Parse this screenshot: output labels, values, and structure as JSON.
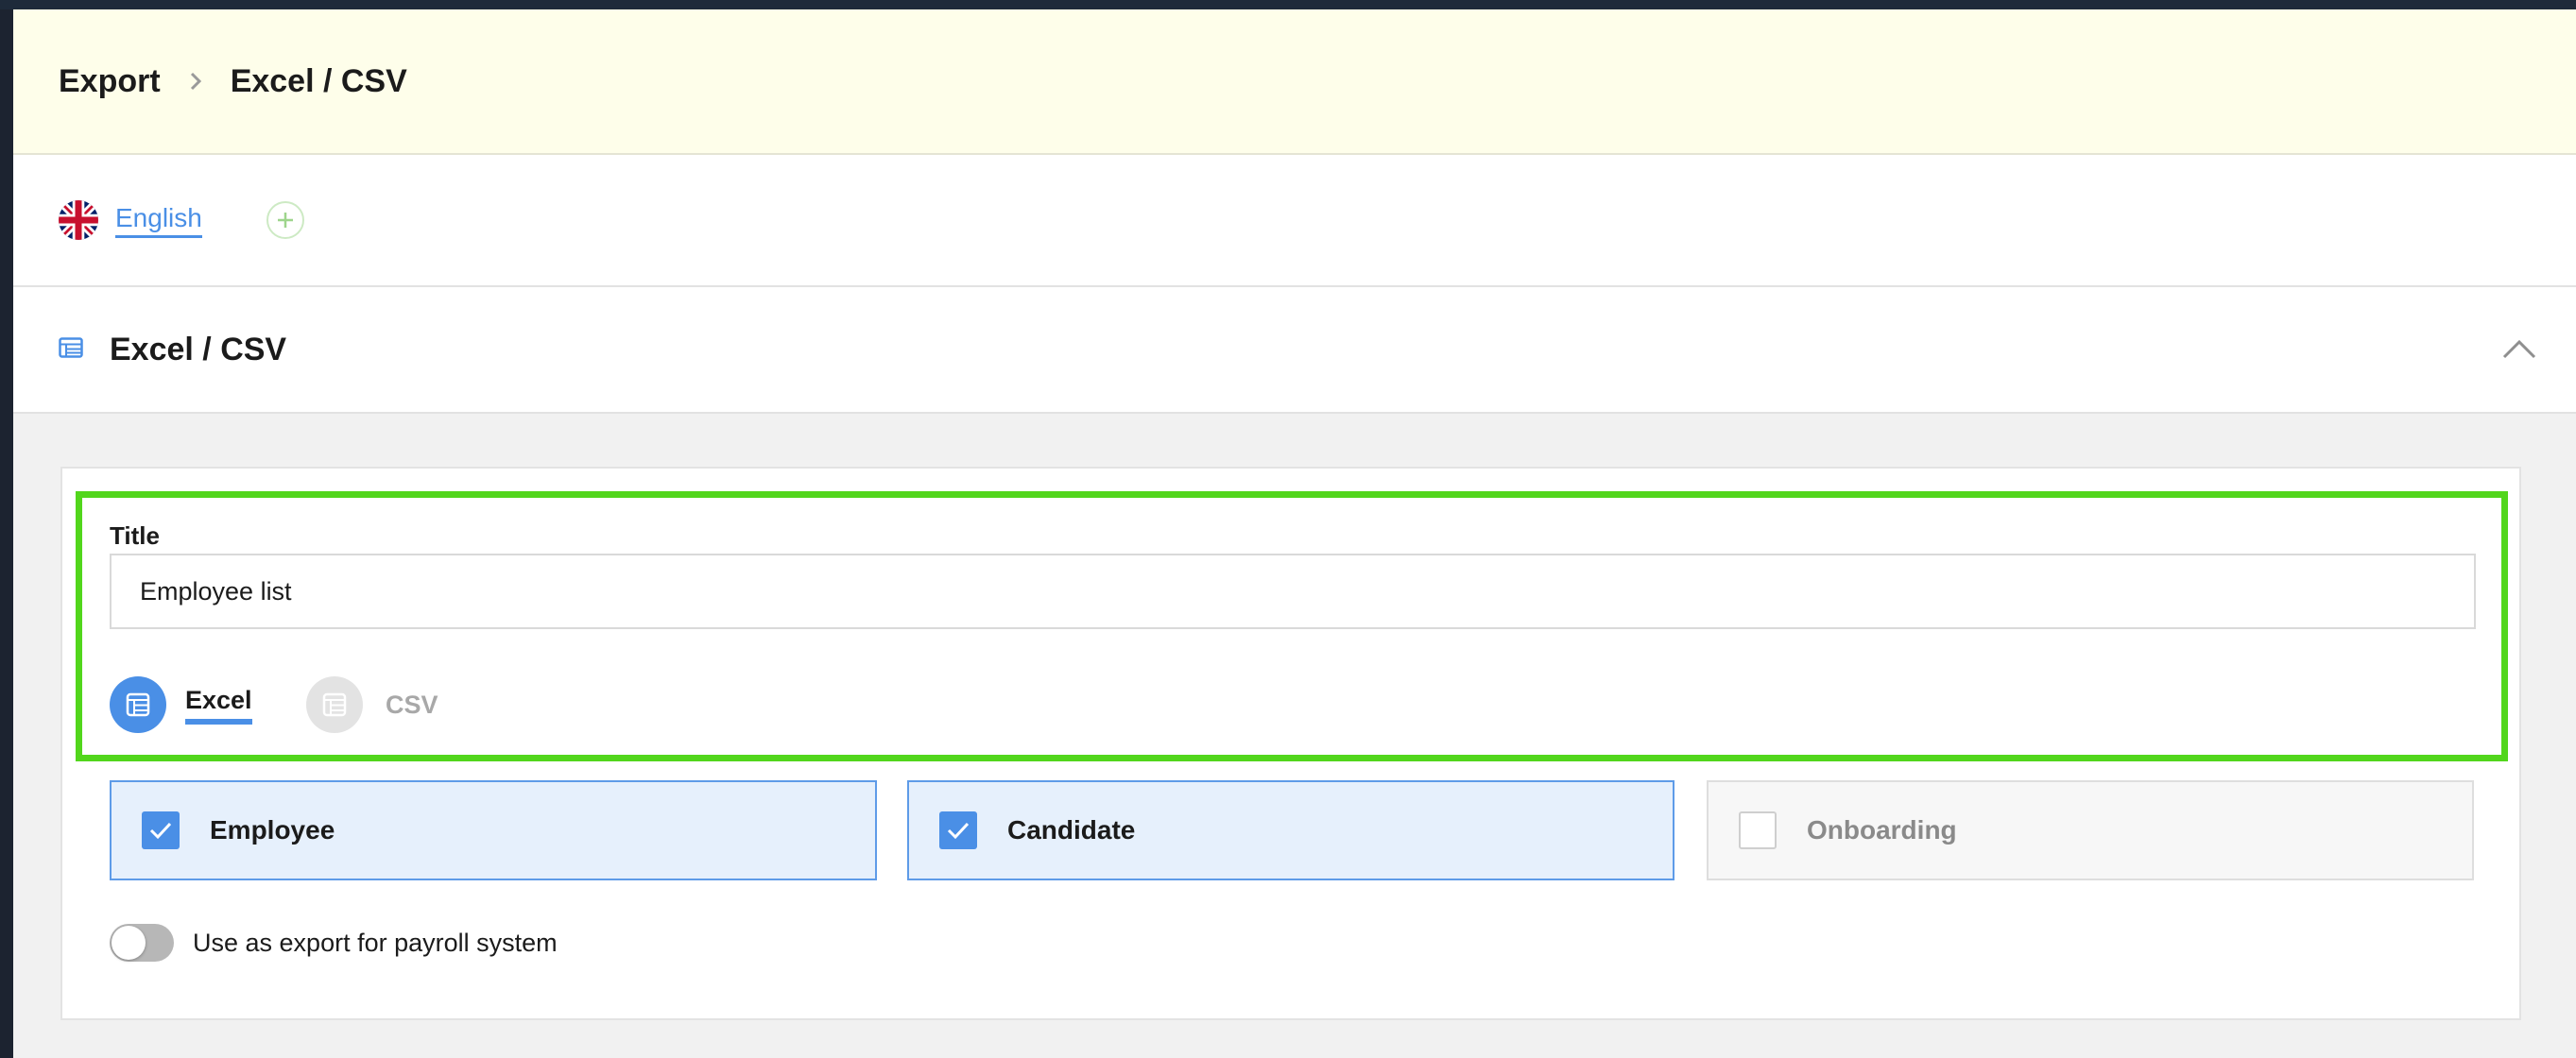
{
  "breadcrumb": {
    "root": "Export",
    "current": "Excel / CSV"
  },
  "languages": {
    "active": "English"
  },
  "section": {
    "title": "Excel / CSV"
  },
  "form": {
    "title_label": "Title",
    "title_value": "Employee list",
    "formats": [
      {
        "label": "Excel",
        "selected": true
      },
      {
        "label": "CSV",
        "selected": false
      }
    ],
    "types": [
      {
        "label": "Employee",
        "checked": true
      },
      {
        "label": "Candidate",
        "checked": true
      },
      {
        "label": "Onboarding",
        "checked": false
      }
    ],
    "payroll_toggle_label": "Use as export for payroll system",
    "payroll_toggle_on": false
  },
  "colors": {
    "header_bg": "#fefeea",
    "accent": "#4a8fe6",
    "highlight_outline": "#52d61c",
    "checked_bg": "#e6f0fc"
  },
  "icons": {
    "breadcrumb_separator": "chevron-right-icon",
    "language_flag": "uk-flag-icon",
    "add_language": "plus-icon",
    "section": "table-icon",
    "collapse": "chevron-up-icon",
    "format": "spreadsheet-icon",
    "checkbox": "checkmark-icon"
  }
}
